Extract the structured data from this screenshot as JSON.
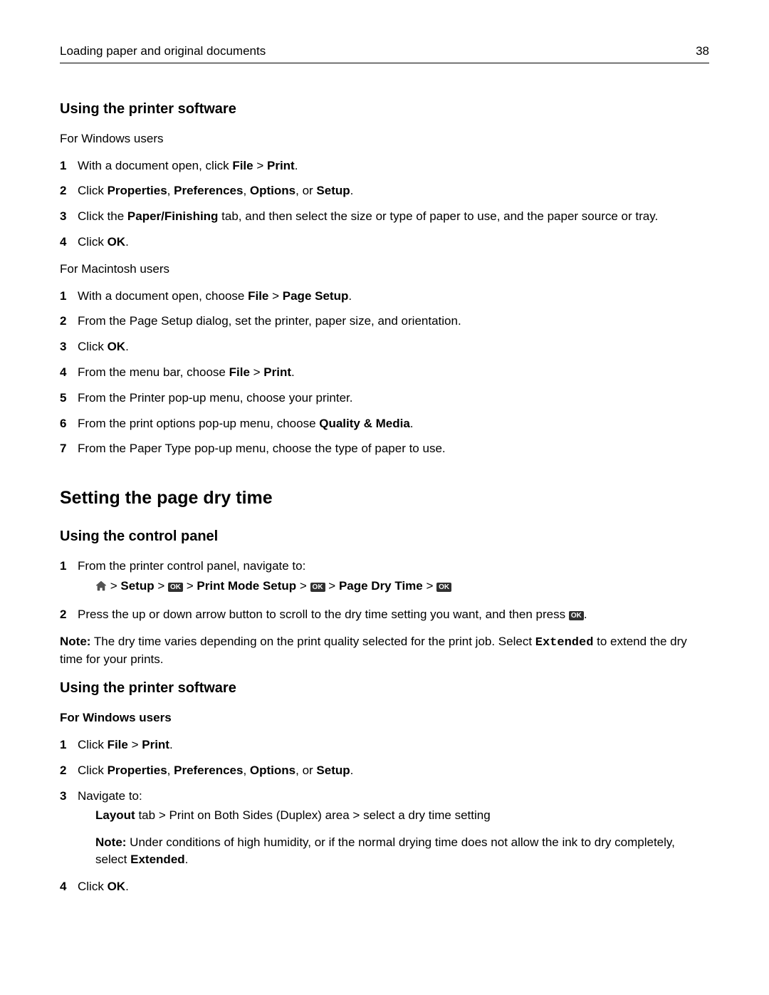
{
  "header": {
    "title": "Loading paper and original documents",
    "page_number": "38"
  },
  "s1": {
    "heading": "Using the printer software",
    "win_intro": "For Windows users",
    "win_steps": [
      {
        "pre": "With a document open, click ",
        "b1": "File",
        "mid": " > ",
        "b2": "Print",
        "post": "."
      },
      {
        "pre": "Click ",
        "b1": "Properties",
        "mid": ", ",
        "b2": "Preferences",
        "mid2": ", ",
        "b3": "Options",
        "mid3": ", or ",
        "b4": "Setup",
        "post": "."
      },
      {
        "pre": "Click the ",
        "b1": "Paper/Finishing",
        "post": " tab, and then select the size or type of paper to use, and the paper source or tray."
      },
      {
        "pre": "Click ",
        "b1": "OK",
        "post": "."
      }
    ],
    "mac_intro": "For Macintosh users",
    "mac_steps": [
      {
        "pre": "With a document open, choose ",
        "b1": "File",
        "mid": " > ",
        "b2": "Page Setup",
        "post": "."
      },
      {
        "plain": "From the Page Setup dialog, set the printer, paper size, and orientation."
      },
      {
        "pre": "Click ",
        "b1": "OK",
        "post": "."
      },
      {
        "pre": "From the menu bar, choose ",
        "b1": "File",
        "mid": " > ",
        "b2": "Print",
        "post": "."
      },
      {
        "plain": "From the Printer pop‑up menu, choose your printer."
      },
      {
        "pre": "From the print options pop‑up menu, choose ",
        "b1": "Quality & Media",
        "post": "."
      },
      {
        "plain": "From the Paper Type pop‑up menu, choose the type of paper to use."
      }
    ]
  },
  "s2": {
    "heading": "Setting the page dry time",
    "cp": {
      "heading": "Using the control panel",
      "step1": "From the printer control panel, navigate to:",
      "path": {
        "sep": " > ",
        "setup": "Setup",
        "pms": "Print Mode Setup",
        "pdt": "Page Dry Time",
        "ok": "OK"
      },
      "step2_pre": "Press the up or down arrow button to scroll to the dry time setting you want, and then press ",
      "step2_post": ".",
      "note_label": "Note:",
      "note_body_pre": " The dry time varies depending on the print quality selected for the print job. Select ",
      "note_extended": "Extended",
      "note_body_post": " to extend the dry time for your prints."
    },
    "sw": {
      "heading": "Using the printer software",
      "win_heading": "For Windows users",
      "steps": {
        "s1_pre": "Click ",
        "s1_b1": "File",
        "s1_mid": " > ",
        "s1_b2": "Print",
        "s1_post": ".",
        "s2_pre": "Click ",
        "s2_b1": "Properties",
        "s2_m1": ", ",
        "s2_b2": "Preferences",
        "s2_m2": ", ",
        "s2_b3": "Options",
        "s2_m3": ", or ",
        "s2_b4": "Setup",
        "s2_post": ".",
        "s3": "Navigate to:",
        "s3_sub_b": "Layout",
        "s3_sub_rest": " tab > Print on Both Sides (Duplex) area > select a dry time setting",
        "s3_note_label": "Note:",
        "s3_note_body_pre": " Under conditions of high humidity, or if the normal drying time does not allow the ink to dry completely, select ",
        "s3_note_b": "Extended",
        "s3_note_post": ".",
        "s4_pre": "Click ",
        "s4_b": "OK",
        "s4_post": "."
      }
    }
  }
}
